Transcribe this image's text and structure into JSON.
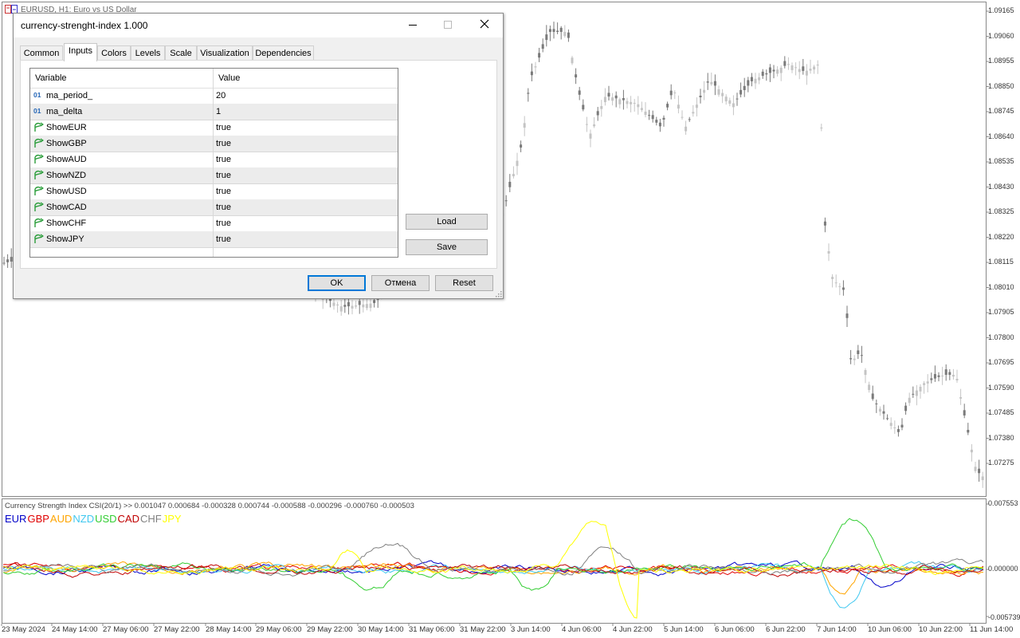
{
  "window": {
    "title": "EURUSD, H1:  Euro vs US Dollar"
  },
  "price_axis": {
    "labels": [
      "1.09165",
      "1.09060",
      "1.08955",
      "1.08850",
      "1.08745",
      "1.08640",
      "1.08535",
      "1.08430",
      "1.08325",
      "1.08220",
      "1.08115",
      "1.08010",
      "1.07905",
      "1.07800",
      "1.07695",
      "1.07590",
      "1.07485",
      "1.07380",
      "1.07275"
    ]
  },
  "indicator_axis": {
    "labels": [
      "0.007553",
      "0.000000",
      "-0.005739"
    ]
  },
  "time_axis": {
    "labels": [
      "23 May 2024",
      "24 May 14:00",
      "27 May 06:00",
      "27 May 22:00",
      "28 May 14:00",
      "29 May 06:00",
      "29 May 22:00",
      "30 May 14:00",
      "31 May 06:00",
      "31 May 22:00",
      "3 Jun 14:00",
      "4 Jun 06:00",
      "4 Jun 22:00",
      "5 Jun 14:00",
      "6 Jun 06:00",
      "6 Jun 22:00",
      "7 Jun 14:00",
      "10 Jun 06:00",
      "10 Jun 22:00",
      "11 Jun 14:00"
    ]
  },
  "indicator": {
    "title": "Currency Strength Index CSI(20/1) >> 0.001047 0.000684 -0.000328 0.000744 -0.000588 -0.000296 -0.000760 -0.000503",
    "legend": [
      {
        "name": "EUR",
        "color": "#0000c8"
      },
      {
        "name": "GBP",
        "color": "#e00000"
      },
      {
        "name": "AUD",
        "color": "#ffa500"
      },
      {
        "name": "NZD",
        "color": "#40c8f0"
      },
      {
        "name": "USD",
        "color": "#32cd32"
      },
      {
        "name": "CAD",
        "color": "#c00000"
      },
      {
        "name": "CHF",
        "color": "#808080"
      },
      {
        "name": "JPY",
        "color": "#ffff00"
      }
    ]
  },
  "dialog": {
    "title": "currency-strenght-index 1.000",
    "tabs": [
      "Common",
      "Inputs",
      "Colors",
      "Levels",
      "Scale",
      "Visualization",
      "Dependencies"
    ],
    "active_tab": "Inputs",
    "grid": {
      "headers": {
        "variable": "Variable",
        "value": "Value"
      },
      "rows": [
        {
          "icon": "numeric-icon",
          "icon_text": "01",
          "name": "ma_period_",
          "value": "20"
        },
        {
          "icon": "numeric-icon",
          "icon_text": "01",
          "name": "ma_delta",
          "value": "1"
        },
        {
          "icon": "bool-icon",
          "name": "ShowEUR",
          "value": "true"
        },
        {
          "icon": "bool-icon",
          "name": "ShowGBP",
          "value": "true"
        },
        {
          "icon": "bool-icon",
          "name": "ShowAUD",
          "value": "true"
        },
        {
          "icon": "bool-icon",
          "name": "ShowNZD",
          "value": "true"
        },
        {
          "icon": "bool-icon",
          "name": "ShowUSD",
          "value": "true"
        },
        {
          "icon": "bool-icon",
          "name": "ShowCAD",
          "value": "true"
        },
        {
          "icon": "bool-icon",
          "name": "ShowCHF",
          "value": "true"
        },
        {
          "icon": "bool-icon",
          "name": "ShowJPY",
          "value": "true"
        }
      ]
    },
    "buttons": {
      "load": "Load",
      "save": "Save",
      "ok": "OK",
      "cancel": "Отмена",
      "reset": "Reset"
    }
  }
}
